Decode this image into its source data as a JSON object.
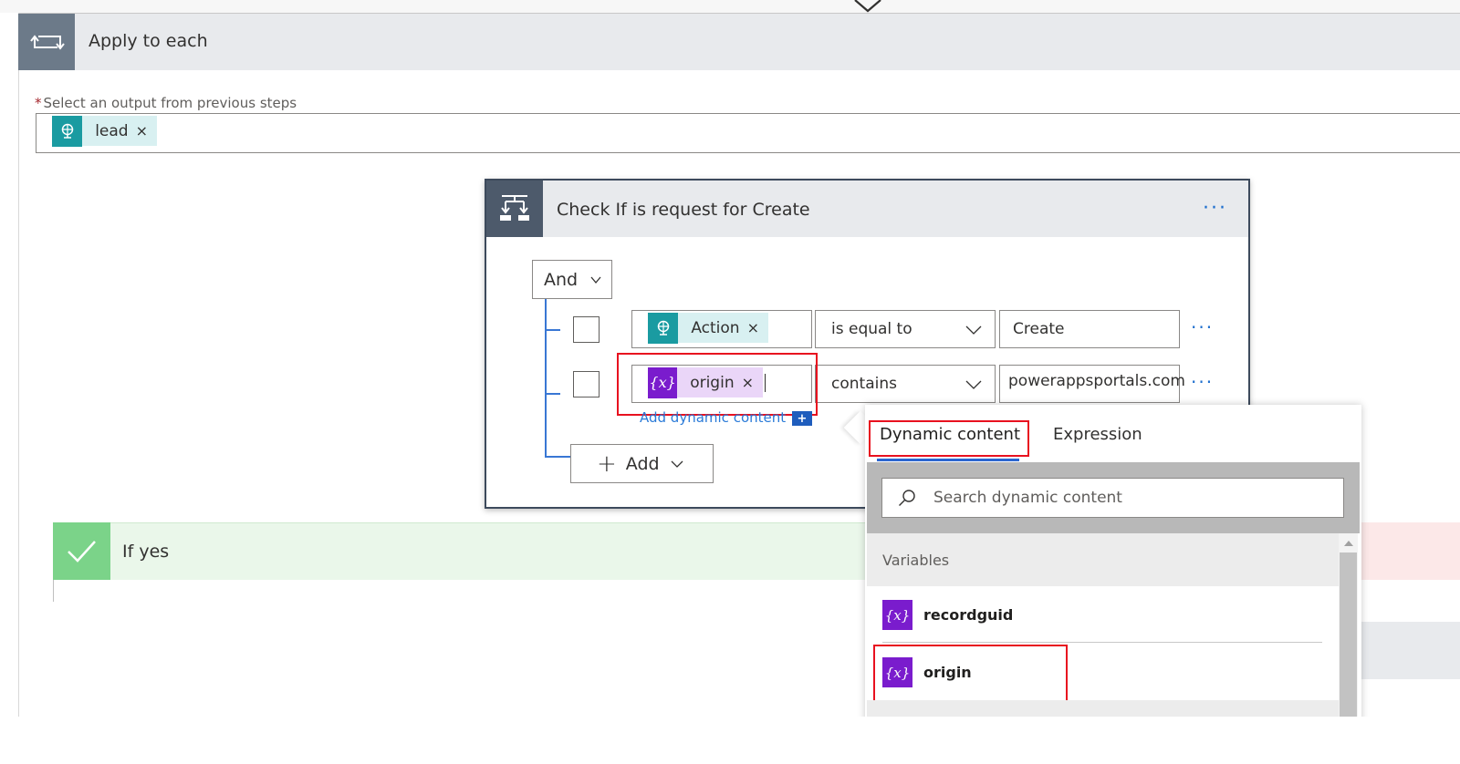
{
  "apply_to_each": {
    "title": "Apply to each",
    "select_label": "Select an output from previous steps",
    "required_marker": "*",
    "token": {
      "label": "lead",
      "remove": "×"
    }
  },
  "condition": {
    "title": "Check If is request for Create",
    "more": "···",
    "group_operator": "And",
    "rows": [
      {
        "token": "Action",
        "remove": "×",
        "operator": "is equal to",
        "value": "Create",
        "more": "···"
      },
      {
        "token": "origin",
        "remove": "×",
        "operator": "contains",
        "value": "powerappsportals.com",
        "more": "···"
      }
    ],
    "add_dynamic_content": "Add dynamic content",
    "add_dynamic_plus": "+",
    "add_button": "Add"
  },
  "if_yes": {
    "title": "If yes"
  },
  "dynamic_panel": {
    "tabs": [
      "Dynamic content",
      "Expression"
    ],
    "active_tab": "Dynamic content",
    "search_placeholder": "Search dynamic content",
    "section": "Variables",
    "items": [
      {
        "label": "recordguid",
        "icon": "variable-icon"
      },
      {
        "label": "origin",
        "icon": "variable-icon"
      }
    ],
    "variable_glyph": "{x}"
  },
  "colors": {
    "teal": "#1a9ba1",
    "purple": "#7a1ccd",
    "highlight": "#e8111f",
    "link": "#2b7bd8",
    "yes_green": "#7bd389"
  }
}
